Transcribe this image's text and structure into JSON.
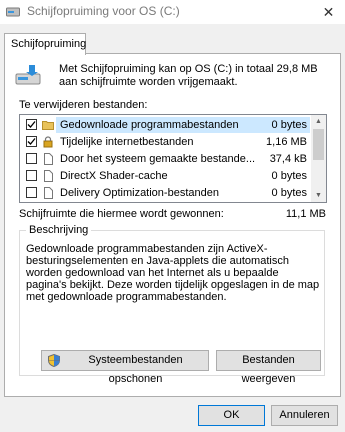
{
  "window": {
    "title": "Schijfopruiming voor OS (C:)",
    "close_glyph": "✕"
  },
  "tab": {
    "label": "Schijfopruiming"
  },
  "summary": "Met Schijfopruiming kan op OS (C:) in totaal 29,8 MB aan schijfruimte worden vrijgemaakt.",
  "files_label": "Te verwijderen bestanden:",
  "files": [
    {
      "name": "Gedownloade programmabestanden",
      "size": "0 bytes",
      "checked": true,
      "selected": true,
      "icon": "folder-icon"
    },
    {
      "name": "Tijdelijke internetbestanden",
      "size": "1,16 MB",
      "checked": true,
      "selected": false,
      "icon": "lock-icon"
    },
    {
      "name": "Door het systeem gemaakte bestande...",
      "size": "37,4 kB",
      "checked": false,
      "selected": false,
      "icon": "file-icon"
    },
    {
      "name": "DirectX Shader-cache",
      "size": "0 bytes",
      "checked": false,
      "selected": false,
      "icon": "file-icon"
    },
    {
      "name": "Delivery Optimization-bestanden",
      "size": "0 bytes",
      "checked": false,
      "selected": false,
      "icon": "file-icon"
    }
  ],
  "gain": {
    "label": "Schijfruimte die hiermee wordt gewonnen:",
    "value": "11,1 MB"
  },
  "description": {
    "title": "Beschrijving",
    "text": "Gedownloade programmabestanden zijn ActiveX-besturingselementen en Java-applets die automatisch worden gedownload van het Internet als u bepaalde pagina's bekijkt. Deze worden tijdelijk opgeslagen in de map met gedownloade programmabestanden."
  },
  "buttons": {
    "system_cleanup": "Systeembestanden opschonen",
    "view_files": "Bestanden weergeven",
    "ok": "OK",
    "cancel": "Annuleren"
  }
}
